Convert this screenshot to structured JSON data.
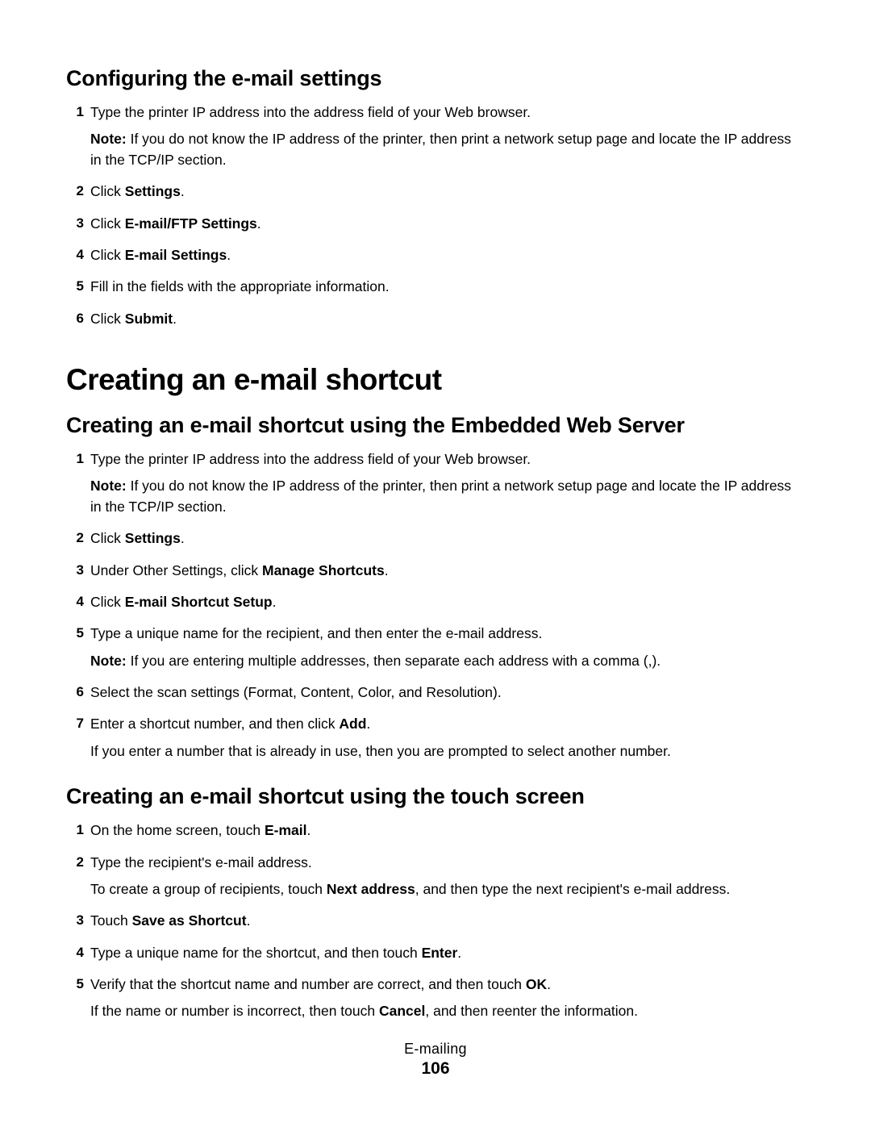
{
  "sections": {
    "configure": {
      "heading": "Configuring the e-mail settings",
      "steps": {
        "s1": {
          "text": "Type the printer IP address into the address field of your Web browser.",
          "note_strong": "Note:",
          "note_rest": " If you do not know the IP address of the printer, then print a network setup page and locate the IP address in the TCP/IP section."
        },
        "s2": {
          "pre": "Click ",
          "strong": "Settings",
          "post": "."
        },
        "s3": {
          "pre": "Click ",
          "strong": "E-mail/FTP Settings",
          "post": "."
        },
        "s4": {
          "pre": "Click ",
          "strong": "E-mail Settings",
          "post": "."
        },
        "s5": {
          "text": "Fill in the fields with the appropriate information."
        },
        "s6": {
          "pre": "Click ",
          "strong": "Submit",
          "post": "."
        }
      }
    },
    "shortcut_main": {
      "heading": "Creating an e-mail shortcut"
    },
    "ews": {
      "heading": "Creating an e-mail shortcut using the Embedded Web Server",
      "steps": {
        "s1": {
          "text": "Type the printer IP address into the address field of your Web browser.",
          "note_strong": "Note:",
          "note_rest": " If you do not know the IP address of the printer, then print a network setup page and locate the IP address in the TCP/IP section."
        },
        "s2": {
          "pre": "Click ",
          "strong": "Settings",
          "post": "."
        },
        "s3": {
          "pre": "Under Other Settings, click ",
          "strong": "Manage Shortcuts",
          "post": "."
        },
        "s4": {
          "pre": "Click ",
          "strong": "E-mail Shortcut Setup",
          "post": "."
        },
        "s5": {
          "text": "Type a unique name for the recipient, and then enter the e-mail address.",
          "note_strong": "Note:",
          "note_rest": " If you are entering multiple addresses, then separate each address with a comma (,)."
        },
        "s6": {
          "text": "Select the scan settings (Format, Content, Color, and Resolution)."
        },
        "s7": {
          "pre": "Enter a shortcut number, and then click ",
          "strong": "Add",
          "post": ".",
          "after": "If you enter a number that is already in use, then you are prompted to select another number."
        }
      }
    },
    "touch": {
      "heading": "Creating an e-mail shortcut using the touch screen",
      "steps": {
        "s1": {
          "pre": "On the home screen, touch ",
          "strong": "E-mail",
          "post": "."
        },
        "s2": {
          "text": "Type the recipient's e-mail address.",
          "after_pre": "To create a group of recipients, touch ",
          "after_strong": "Next address",
          "after_post": ", and then type the next recipient's e-mail address."
        },
        "s3": {
          "pre": "Touch ",
          "strong": "Save as Shortcut",
          "post": "."
        },
        "s4": {
          "pre": "Type a unique name for the shortcut, and then touch ",
          "strong": "Enter",
          "post": "."
        },
        "s5": {
          "pre": "Verify that the shortcut name and number are correct, and then touch ",
          "strong": "OK",
          "post": ".",
          "after_pre": "If the name or number is incorrect, then touch ",
          "after_strong": "Cancel",
          "after_post": ", and then reenter the information."
        }
      }
    }
  },
  "footer": {
    "category": "E-mailing",
    "page_number": "106"
  }
}
